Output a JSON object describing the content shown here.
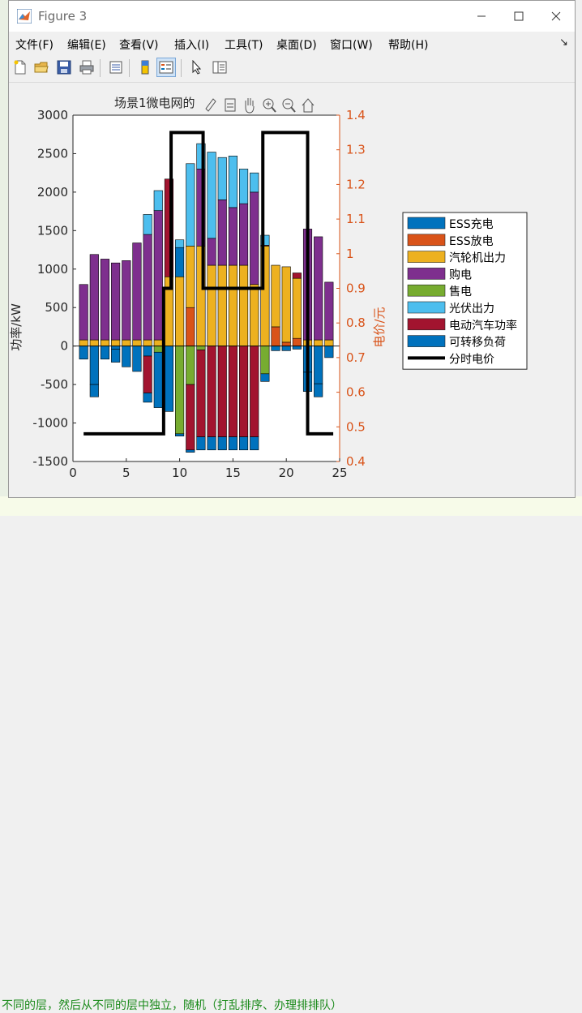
{
  "window": {
    "title": "Figure 3",
    "controls": {
      "minimize": "—",
      "maximize": "☐",
      "close": "✕"
    }
  },
  "menu": [
    "文件(F)",
    "编辑(E)",
    "查看(V)",
    "插入(I)",
    "工具(T)",
    "桌面(D)",
    "窗口(W)",
    "帮助(H)"
  ],
  "menu_arrow": "↘",
  "toolbar_icons": [
    "new-file-icon",
    "open-folder-icon",
    "save-icon",
    "print-icon",
    "print-preview-icon",
    "colorbar-icon",
    "legend-icon",
    "pointer-icon",
    "property-editor-icon"
  ],
  "axes_toolbar_icons": [
    "brush-icon",
    "data-tip-icon",
    "pan-icon",
    "zoom-in-icon",
    "zoom-out-icon",
    "home-icon"
  ],
  "background_text": "不同的层，然后从不同的层中独立，随机（打乱排序、办理排排队）",
  "colors": {
    "ess_charge": "#0072BD",
    "ess_discharge": "#D95319",
    "turbine": "#EDB120",
    "buy": "#7E2F8E",
    "sell": "#77AC30",
    "pv": "#4DBEEE",
    "ev": "#A2142F",
    "shift": "#0072BD",
    "price": "#000000",
    "right_axis": "#D95319"
  },
  "chart_data": {
    "type": "bar",
    "title": "场景1微电网的",
    "xlabel": "",
    "ylabel": "功率/kW",
    "ylabel_right": "电价/元",
    "xlim": [
      0,
      25
    ],
    "ylim": [
      -1500,
      3000
    ],
    "ylim_right": [
      0.4,
      1.4
    ],
    "xticks": [
      "0",
      "5",
      "10",
      "15",
      "20",
      "25"
    ],
    "yticks": [
      "-1500",
      "-1000",
      "-500",
      "0",
      "500",
      "1000",
      "1500",
      "2000",
      "2500",
      "3000"
    ],
    "yticks_right": [
      "0.4",
      "0.5",
      "0.6",
      "0.7",
      "0.8",
      "0.9",
      "1",
      "1.1",
      "1.2",
      "1.3",
      "1.4"
    ],
    "legend_position": "outside-right",
    "categories": [
      1,
      2,
      3,
      4,
      5,
      6,
      7,
      8,
      9,
      10,
      11,
      12,
      13,
      14,
      15,
      16,
      17,
      18,
      19,
      20,
      21,
      22,
      23,
      24
    ],
    "series": [
      {
        "name": "ESS充电",
        "key": "ess_charge",
        "values": [
          0,
          0,
          0,
          0,
          0,
          0,
          0,
          0,
          0,
          0,
          0,
          0,
          0,
          0,
          0,
          0,
          0,
          0,
          0,
          0,
          0,
          0,
          0,
          0
        ],
        "neg": [
          0,
          -500,
          0,
          0,
          0,
          0,
          -80,
          -80,
          0,
          0,
          0,
          0,
          0,
          0,
          0,
          0,
          0,
          -50,
          0,
          0,
          0,
          -350,
          0,
          0
        ]
      },
      {
        "name": "ESS放电",
        "key": "ess_discharge",
        "values": [
          0,
          0,
          0,
          0,
          0,
          0,
          0,
          0,
          0,
          0,
          500,
          0,
          0,
          0,
          0,
          0,
          0,
          200,
          250,
          50,
          100,
          0,
          0,
          0
        ]
      },
      {
        "name": "汽轮机出力",
        "key": "turbine",
        "values": [
          80,
          80,
          80,
          80,
          80,
          80,
          80,
          80,
          900,
          1000,
          800,
          1300,
          900,
          1050,
          1050,
          1050,
          800,
          1100,
          800,
          1000,
          750,
          900,
          80,
          80
        ]
      },
      {
        "name": "购电",
        "key": "buy",
        "values": [
          720,
          1110,
          1050,
          1000,
          1030,
          1260,
          1240,
          1050,
          0,
          0,
          0,
          0,
          0,
          0,
          0,
          0,
          0,
          0,
          0,
          0,
          0,
          0,
          1320,
          750
        ]
      },
      {
        "name": "售电",
        "key": "sell",
        "values": [
          0,
          0,
          0,
          0,
          0,
          0,
          0,
          0,
          0,
          -830,
          -1100,
          -480,
          0,
          0,
          0,
          0,
          0,
          0,
          -350,
          0,
          0,
          0,
          0,
          0
        ]
      },
      {
        "name": "光伏出力",
        "key": "pv",
        "values": [
          0,
          0,
          0,
          0,
          0,
          0,
          0,
          0,
          0,
          0,
          0,
          0,
          0,
          0,
          0,
          0,
          0,
          0,
          0,
          0,
          0,
          0,
          0,
          0
        ]
      },
      {
        "name": "电动汽车功率",
        "key": "ev",
        "values": [
          0,
          0,
          0,
          0,
          0,
          0,
          0,
          0,
          0,
          0,
          0,
          0,
          0,
          0,
          0,
          0,
          0,
          0,
          0,
          0,
          0,
          0,
          0,
          0
        ]
      },
      {
        "name": "可转移负荷",
        "key": "shift",
        "values": [
          0,
          0,
          0,
          0,
          0,
          0,
          0,
          0,
          0,
          0,
          0,
          0,
          0,
          0,
          0,
          0,
          0,
          0,
          0,
          0,
          0,
          0,
          0,
          0
        ]
      },
      {
        "name": "分时电价",
        "key": "price",
        "values": [
          0.48,
          0.48,
          0.48,
          0.48,
          0.48,
          0.48,
          0.48,
          0.48,
          0.9,
          1.35,
          1.35,
          1.35,
          0.9,
          0.9,
          0.9,
          0.9,
          0.9,
          1.35,
          1.35,
          1.35,
          1.35,
          1.35,
          0.48,
          0.48
        ]
      }
    ],
    "stacks": [
      {
        "x": 1,
        "pos": [
          [
            "turbine",
            80
          ],
          [
            "buy",
            720
          ]
        ],
        "neg": [
          [
            "shift",
            -170
          ]
        ]
      },
      {
        "x": 2,
        "pos": [
          [
            "turbine",
            80
          ],
          [
            "buy",
            1110
          ]
        ],
        "neg": [
          [
            "shift",
            -500
          ],
          [
            "ess_charge",
            -160
          ]
        ]
      },
      {
        "x": 3,
        "pos": [
          [
            "turbine",
            80
          ],
          [
            "buy",
            1050
          ]
        ],
        "neg": [
          [
            "shift",
            -170
          ]
        ]
      },
      {
        "x": 4,
        "pos": [
          [
            "turbine",
            80
          ],
          [
            "buy",
            1000
          ]
        ],
        "neg": [
          [
            "ess_charge",
            -40
          ],
          [
            "shift",
            -170
          ]
        ]
      },
      {
        "x": 5,
        "pos": [
          [
            "turbine",
            80
          ],
          [
            "buy",
            1030
          ]
        ],
        "neg": [
          [
            "shift",
            -270
          ]
        ]
      },
      {
        "x": 6,
        "pos": [
          [
            "turbine",
            80
          ],
          [
            "buy",
            1260
          ]
        ],
        "neg": [
          [
            "shift",
            -330
          ]
        ]
      },
      {
        "x": 7,
        "pos": [
          [
            "turbine",
            80
          ],
          [
            "buy",
            1370
          ],
          [
            "pv",
            260
          ]
        ],
        "neg": [
          [
            "shift",
            -130
          ],
          [
            "ev",
            -480
          ],
          [
            "shift",
            -120
          ]
        ]
      },
      {
        "x": 8,
        "pos": [
          [
            "turbine",
            80
          ],
          [
            "buy",
            1680
          ],
          [
            "pv",
            260
          ]
        ],
        "neg": [
          [
            "sell",
            -80
          ],
          [
            "shift",
            -720
          ]
        ]
      },
      {
        "x": 9,
        "pos": [
          [
            "turbine",
            900
          ],
          [
            "ev",
            1270
          ]
        ],
        "neg": [
          [
            "shift",
            -850
          ]
        ]
      },
      {
        "x": 10,
        "pos": [
          [
            "turbine",
            900
          ],
          [
            "shift",
            380
          ],
          [
            "pv",
            100
          ]
        ],
        "neg": [
          [
            "sell",
            -1140
          ],
          [
            "shift",
            -30
          ]
        ]
      },
      {
        "x": 11,
        "pos": [
          [
            "ess_discharge",
            500
          ],
          [
            "turbine",
            800
          ],
          [
            "pv",
            1070
          ]
        ],
        "neg": [
          [
            "sell",
            -500
          ],
          [
            "ev",
            -850
          ],
          [
            "shift",
            -30
          ]
        ]
      },
      {
        "x": 12,
        "pos": [
          [
            "turbine",
            1300
          ],
          [
            "buy",
            1000
          ],
          [
            "pv",
            330
          ]
        ],
        "neg": [
          [
            "sell",
            -50
          ],
          [
            "ev",
            -1130
          ],
          [
            "shift",
            -170
          ]
        ]
      },
      {
        "x": 13,
        "pos": [
          [
            "turbine",
            1050
          ],
          [
            "buy",
            350
          ],
          [
            "pv",
            1120
          ]
        ],
        "neg": [
          [
            "ev",
            -1180
          ],
          [
            "shift",
            -170
          ]
        ]
      },
      {
        "x": 14,
        "pos": [
          [
            "turbine",
            1050
          ],
          [
            "buy",
            850
          ],
          [
            "pv",
            550
          ]
        ],
        "neg": [
          [
            "ev",
            -1180
          ],
          [
            "shift",
            -170
          ]
        ]
      },
      {
        "x": 15,
        "pos": [
          [
            "turbine",
            1050
          ],
          [
            "buy",
            750
          ],
          [
            "pv",
            670
          ]
        ],
        "neg": [
          [
            "ev",
            -1180
          ],
          [
            "shift",
            -170
          ]
        ]
      },
      {
        "x": 16,
        "pos": [
          [
            "turbine",
            1050
          ],
          [
            "buy",
            800
          ],
          [
            "pv",
            450
          ]
        ],
        "neg": [
          [
            "ev",
            -1180
          ],
          [
            "shift",
            -170
          ]
        ]
      },
      {
        "x": 17,
        "pos": [
          [
            "turbine",
            800
          ],
          [
            "buy",
            1200
          ],
          [
            "pv",
            250
          ]
        ],
        "neg": [
          [
            "ev",
            -1180
          ],
          [
            "shift",
            -170
          ]
        ]
      },
      {
        "x": 18,
        "pos": [
          [
            "ess_discharge",
            0
          ],
          [
            "turbine",
            1300
          ],
          [
            "buy",
            10
          ],
          [
            "pv",
            130
          ]
        ],
        "neg": [
          [
            "sell",
            -360
          ],
          [
            "shift",
            -100
          ]
        ]
      },
      {
        "x": 19,
        "pos": [
          [
            "ess_discharge",
            250
          ],
          [
            "turbine",
            800
          ]
        ],
        "neg": [
          [
            "shift",
            -60
          ]
        ]
      },
      {
        "x": 20,
        "pos": [
          [
            "ess_discharge",
            50
          ],
          [
            "turbine",
            980
          ]
        ],
        "neg": [
          [
            "shift",
            -60
          ]
        ]
      },
      {
        "x": 21,
        "pos": [
          [
            "ess_discharge",
            100
          ],
          [
            "turbine",
            780
          ],
          [
            "ev",
            70
          ]
        ],
        "neg": [
          [
            "shift",
            -40
          ]
        ]
      },
      {
        "x": 22,
        "pos": [
          [
            "turbine",
            80
          ],
          [
            "buy",
            1440
          ]
        ],
        "neg": [
          [
            "shift",
            -340
          ],
          [
            "ess_charge",
            -250
          ]
        ]
      },
      {
        "x": 23,
        "pos": [
          [
            "turbine",
            80
          ],
          [
            "buy",
            1340
          ]
        ],
        "neg": [
          [
            "shift",
            -490
          ],
          [
            "ess_charge",
            -170
          ]
        ]
      },
      {
        "x": 24,
        "pos": [
          [
            "turbine",
            80
          ],
          [
            "buy",
            750
          ]
        ],
        "neg": [
          [
            "shift",
            -150
          ]
        ]
      }
    ],
    "price_steps": [
      [
        1,
        0.48
      ],
      [
        8.5,
        0.48
      ],
      [
        8.5,
        0.9
      ],
      [
        9.2,
        0.9
      ],
      [
        9.2,
        1.35
      ],
      [
        12.2,
        1.35
      ],
      [
        12.2,
        0.9
      ],
      [
        17.8,
        0.9
      ],
      [
        17.8,
        1.35
      ],
      [
        22,
        1.35
      ],
      [
        22,
        0.48
      ],
      [
        24.4,
        0.48
      ]
    ]
  }
}
